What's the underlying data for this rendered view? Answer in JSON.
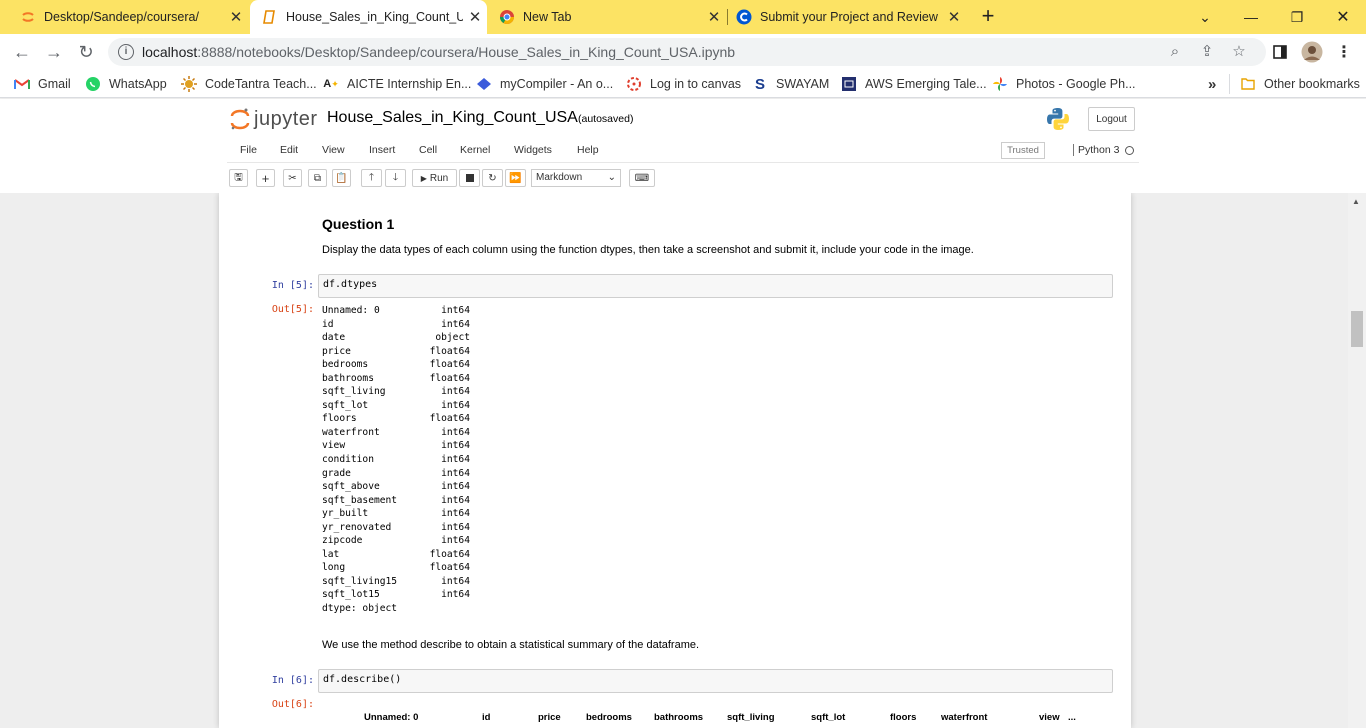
{
  "browser": {
    "tabs": [
      {
        "title": "Desktop/Sandeep/coursera/",
        "icon": "jupyter-icon",
        "active": false
      },
      {
        "title": "House_Sales_in_King_Count_USA",
        "icon": "notebook-icon",
        "active": true
      },
      {
        "title": "New Tab",
        "icon": "chrome-icon",
        "active": false
      },
      {
        "title": "Submit your Project and Review",
        "icon": "coursera-icon",
        "active": false
      }
    ],
    "new_tab_label": "+",
    "url_host": "localhost",
    "url_port_path": ":8888/notebooks/Desktop/Sandeep/coursera/House_Sales_in_King_Count_USA.ipynb",
    "bookmarks": [
      {
        "label": "Gmail",
        "icon": "gmail-icon"
      },
      {
        "label": "WhatsApp",
        "icon": "whatsapp-icon"
      },
      {
        "label": "CodeTantra Teach...",
        "icon": "codetantra-icon"
      },
      {
        "label": "AICTE Internship En...",
        "icon": "aicte-icon"
      },
      {
        "label": "myCompiler - An o...",
        "icon": "mycompiler-icon"
      },
      {
        "label": "Log in to canvas",
        "icon": "canvas-icon"
      },
      {
        "label": "SWAYAM",
        "icon": "swayam-icon"
      },
      {
        "label": "AWS Emerging Tale...",
        "icon": "aws-icon"
      },
      {
        "label": "Photos - Google Ph...",
        "icon": "google-photos-icon"
      }
    ],
    "overflow_label": "»",
    "other_bookmarks": "Other bookmarks"
  },
  "jupyter": {
    "logo_text": "jupyter",
    "notebook_name": "House_Sales_in_King_Count_USA",
    "autosave_status": "(autosaved)",
    "logout_label": "Logout",
    "menu": [
      "File",
      "Edit",
      "View",
      "Insert",
      "Cell",
      "Kernel",
      "Widgets",
      "Help"
    ],
    "trusted_label": "Trusted",
    "kernel_name": "Python 3",
    "run_label": "Run",
    "cell_type": "Markdown"
  },
  "notebook": {
    "question_heading": "Question 1",
    "question_text": "Display the data types of each column using the function dtypes, then take a screenshot and submit it, include your code in the image.",
    "cell1": {
      "in_prompt": "In [5]:",
      "code": "df.dtypes",
      "out_prompt": "Out[5]:"
    },
    "dtypes": [
      {
        "col": "Unnamed: 0",
        "type": "int64"
      },
      {
        "col": "id",
        "type": "int64"
      },
      {
        "col": "date",
        "type": "object"
      },
      {
        "col": "price",
        "type": "float64"
      },
      {
        "col": "bedrooms",
        "type": "float64"
      },
      {
        "col": "bathrooms",
        "type": "float64"
      },
      {
        "col": "sqft_living",
        "type": "int64"
      },
      {
        "col": "sqft_lot",
        "type": "int64"
      },
      {
        "col": "floors",
        "type": "float64"
      },
      {
        "col": "waterfront",
        "type": "int64"
      },
      {
        "col": "view",
        "type": "int64"
      },
      {
        "col": "condition",
        "type": "int64"
      },
      {
        "col": "grade",
        "type": "int64"
      },
      {
        "col": "sqft_above",
        "type": "int64"
      },
      {
        "col": "sqft_basement",
        "type": "int64"
      },
      {
        "col": "yr_built",
        "type": "int64"
      },
      {
        "col": "yr_renovated",
        "type": "int64"
      },
      {
        "col": "zipcode",
        "type": "int64"
      },
      {
        "col": "lat",
        "type": "float64"
      },
      {
        "col": "long",
        "type": "float64"
      },
      {
        "col": "sqft_living15",
        "type": "int64"
      },
      {
        "col": "sqft_lot15",
        "type": "int64"
      }
    ],
    "dtype_footer": "dtype: object",
    "describe_text": "We use the method describe to obtain a statistical summary of the dataframe.",
    "cell2": {
      "in_prompt": "In [6]:",
      "code": "df.describe()",
      "out_prompt": "Out[6]:"
    },
    "table_headers": [
      "Unnamed: 0",
      "id",
      "price",
      "bedrooms",
      "bathrooms",
      "sqft_living",
      "sqft_lot",
      "floors",
      "waterfront",
      "view",
      "..."
    ]
  }
}
